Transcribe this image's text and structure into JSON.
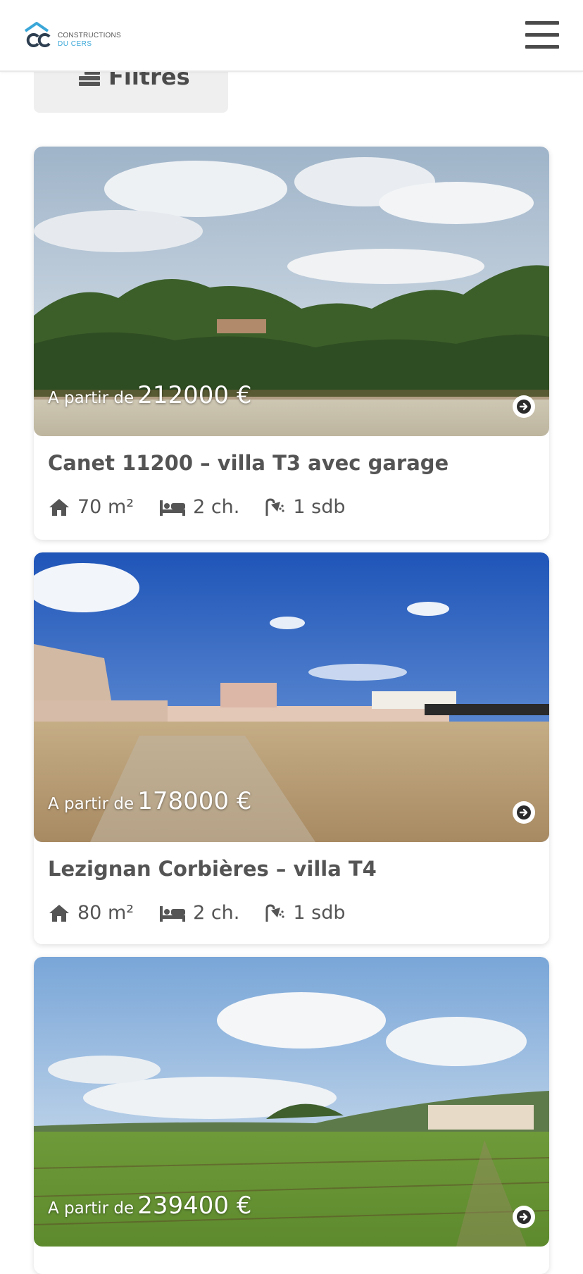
{
  "brand": {
    "line1": "CONSTRUCTIONS",
    "line2": "DU CERS"
  },
  "header": {
    "menu_icon": "hamburger-icon"
  },
  "filters": {
    "label": "Filtres",
    "icon": "filter-lines-icon"
  },
  "listing_common": {
    "price_prefix": "A partir de",
    "arrow_icon": "arrow-right-circle-icon"
  },
  "listings": [
    {
      "price": "212000 €",
      "title": "Canet 11200 – villa T3 avec garage",
      "area": "70 m²",
      "bedrooms": "2 ch.",
      "bathrooms": "1 sdb"
    },
    {
      "price": "178000 €",
      "title": "Lezignan Corbières – villa T4",
      "area": "80 m²",
      "bedrooms": "2 ch.",
      "bathrooms": "1 sdb"
    },
    {
      "price": "239400 €"
    }
  ],
  "colors": {
    "brand_blue": "#3aa7d8",
    "brand_dark": "#2d3e50",
    "text": "#545454",
    "filter_bg": "#efefef"
  }
}
